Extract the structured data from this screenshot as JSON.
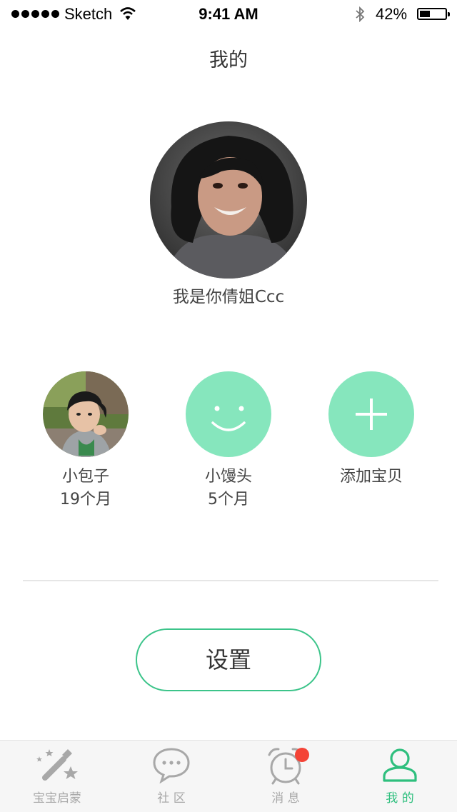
{
  "status_bar": {
    "carrier": "Sketch",
    "time": "9:41 AM",
    "battery": "42%",
    "battery_level": 0.42
  },
  "header": {
    "title": "我的"
  },
  "profile": {
    "name": "我是你倩姐Ccc",
    "avatar_icon": "user-avatar-photo"
  },
  "babies": [
    {
      "name": "小包子",
      "age": "19个月",
      "avatar_icon": "child-photo"
    },
    {
      "name": "小馒头",
      "age": "5个月",
      "avatar_icon": "smiley-icon"
    },
    {
      "name": "添加宝贝",
      "avatar_icon": "plus-icon"
    }
  ],
  "settings": {
    "label": "设置"
  },
  "tabbar": {
    "tabs": [
      {
        "label": "宝宝启蒙",
        "icon": "magic-wand-icon",
        "active": false
      },
      {
        "label": "社 区",
        "icon": "chat-bubble-icon",
        "active": false
      },
      {
        "label": "消 息",
        "icon": "alarm-clock-icon",
        "active": false,
        "badge": true
      },
      {
        "label": "我 的",
        "icon": "person-icon",
        "active": true
      }
    ]
  },
  "colors": {
    "accent": "#2fbf7e",
    "mint": "#86e6bd",
    "badge": "#f44336"
  }
}
